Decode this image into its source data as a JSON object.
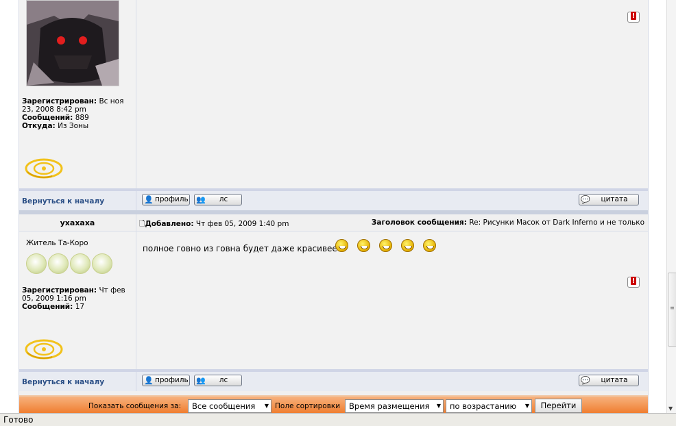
{
  "posts": [
    {
      "registered_label": "Зарегистрирован:",
      "registered_value_l1": "Вс ноя",
      "registered_value_l2": "23, 2008 8:42 pm",
      "messages_label": "Сообщений:",
      "messages_value": "889",
      "from_label": "Откуда:",
      "from_value": "Из Зоны"
    },
    {
      "author": "ухахаха",
      "posted_label": "Добавлено:",
      "posted_value": "Чт фев 05, 2009 1:40 pm",
      "subject_label": "Заголовок сообщения:",
      "subject_value": "Re: Рисунки Масок от Dark Inferno и не только",
      "rank": "Житель Та-Коро",
      "rank_stars": 4,
      "registered_label": "Зарегистрирован:",
      "registered_value_l1": "Чт фев",
      "registered_value_l2": "05, 2009 1:16 pm",
      "messages_label": "Сообщений:",
      "messages_value": "17",
      "text": "полное говно из говна будет даже красивее",
      "smileys": 5
    }
  ],
  "actions": {
    "back_to_top": "Вернуться к началу",
    "profile": "профиль",
    "pm": "лс",
    "quote": "цитата"
  },
  "sortbar": {
    "show_label": "Показать сообщения за:",
    "show_value": "Все сообщения",
    "sort_label": "Поле сортировки",
    "sort_value": "Время размещения",
    "order_value": "по возрастанию",
    "go": "Перейти"
  },
  "status": "Готово",
  "colors": {
    "link": "#2b4f86",
    "orange_bar": "#ef7a2a",
    "panel": "#f2f2f2"
  }
}
